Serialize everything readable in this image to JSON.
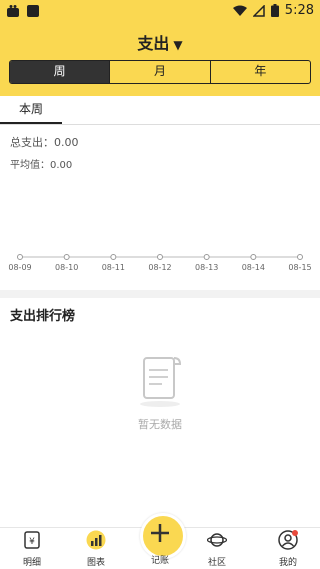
{
  "status_bar": {
    "time": "5:28"
  },
  "header": {
    "title": "支出",
    "dropdown_icon": "caret-down-icon"
  },
  "period_tabs": [
    "周",
    "月",
    "年"
  ],
  "subtab": "本周",
  "summary": {
    "total": "总支出：0.00",
    "average": "平均值：0.00"
  },
  "chart_data": {
    "type": "line",
    "x": [
      "08-09",
      "08-10",
      "08-11",
      "08-12",
      "08-13",
      "08-14",
      "08-15"
    ],
    "series": [
      {
        "values": [
          0,
          0,
          0,
          0,
          0,
          0,
          0
        ]
      }
    ]
  },
  "ranking": {
    "title": "支出排行榜",
    "empty_text": "暂无数据"
  },
  "nav": {
    "items": [
      "明细",
      "图表",
      "记账",
      "社区",
      "我的"
    ]
  },
  "colors": {
    "accent": "#fad851",
    "dark": "#333333",
    "badge": "#e84a3c"
  }
}
